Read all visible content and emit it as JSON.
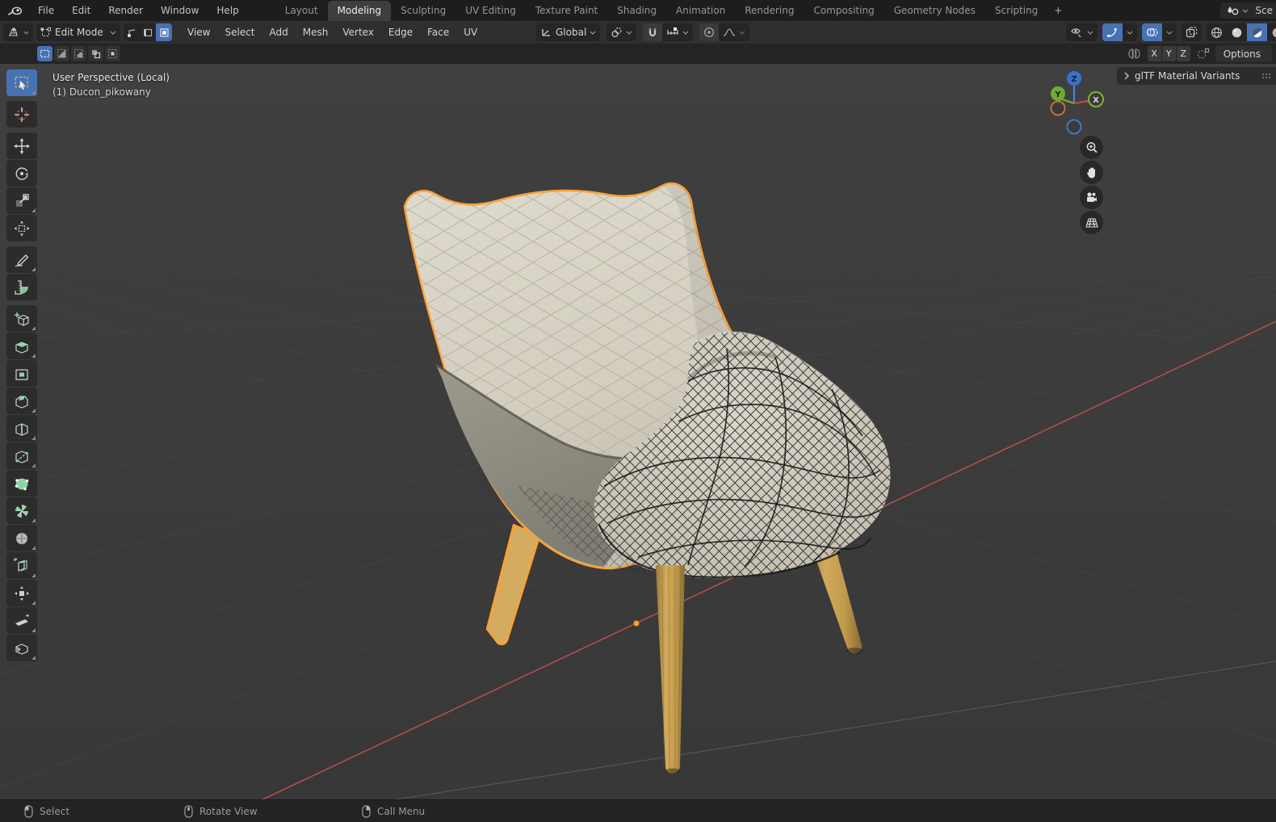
{
  "topbar": {
    "menus": [
      "File",
      "Edit",
      "Render",
      "Window",
      "Help"
    ],
    "tabs": [
      "Layout",
      "Modeling",
      "Sculpting",
      "UV Editing",
      "Texture Paint",
      "Shading",
      "Animation",
      "Rendering",
      "Compositing",
      "Geometry Nodes",
      "Scripting"
    ],
    "active_tab": "Modeling",
    "add_tab_label": "+",
    "scene_label_clipped": "Sce",
    "icons": [
      "blender-logo",
      "scene-icon",
      "chevron-down-icon"
    ]
  },
  "header": {
    "mode_label": "Edit Mode",
    "menus": [
      "View",
      "Select",
      "Add",
      "Mesh",
      "Vertex",
      "Edge",
      "Face",
      "UV"
    ],
    "orientation_label": "Global",
    "icons": [
      "editor-type-icon",
      "edit-mode-icon",
      "vertex-select-icon",
      "edge-select-icon",
      "face-select-icon",
      "orientation-icon",
      "pivot-icon",
      "snap-magnet-icon",
      "snap-increment-icon",
      "proportional-icon",
      "falloff-icon",
      "visibility-icon",
      "gizmos-icon",
      "overlays-icon",
      "xray-icon",
      "shading-wireframe-icon",
      "shading-solid-icon",
      "shading-material-icon",
      "shading-rendered-icon"
    ],
    "active_select_mode": "face",
    "active_shading": "material-preview"
  },
  "tool_settings": {
    "select_mode_icons": [
      "select-set-icon",
      "select-extend-icon",
      "select-subtract-icon",
      "select-difference-icon",
      "select-intersect-icon"
    ],
    "mirror_icon": "mirror-butterfly-icon",
    "axis_labels": [
      "X",
      "Y",
      "Z"
    ],
    "snap_icon": "proportional-snap-icon",
    "options_label": "Options"
  },
  "viewport": {
    "overlay_line1": "User Perspective (Local)",
    "overlay_line2": "(1) Ducon_pikowany",
    "object_name": "Ducon_pikowany"
  },
  "toolbar": {
    "tools": [
      "select-box",
      "cursor",
      "move",
      "rotate",
      "scale",
      "transform",
      "annotate",
      "measure",
      "add-cube",
      "extrude-region",
      "inset-faces",
      "bevel",
      "loop-cut",
      "knife",
      "poly-build",
      "spin",
      "smooth",
      "edge-slide",
      "shrink-fatten",
      "shear",
      "rip-region"
    ],
    "active_tool": "select-box"
  },
  "gizmo": {
    "axis_x": "X",
    "axis_y": "Y",
    "axis_z": "Z",
    "nav_icons": [
      "zoom-icon",
      "pan-hand-icon",
      "camera-view-icon",
      "orthographic-grid-icon"
    ]
  },
  "sidebar": {
    "panel_title": "glTF Material Variants",
    "icons": [
      "expand-chevron-icon",
      "drag-dots-icon"
    ]
  },
  "statusbar": {
    "items": [
      {
        "icon": "mouse-left-icon",
        "label": "Select"
      },
      {
        "icon": "mouse-middle-icon",
        "label": "Rotate View"
      },
      {
        "icon": "mouse-right-icon",
        "label": "Call Menu"
      }
    ]
  },
  "colors": {
    "accent_blue": "#4772b3",
    "selection_orange": "#ffa133",
    "axis_red": "#b5504c",
    "wood": "#c9a254",
    "cushion_cream": "#d6d2c4",
    "side_gray": "#8f8c81",
    "viewport_bg": "#3b3b3b"
  }
}
